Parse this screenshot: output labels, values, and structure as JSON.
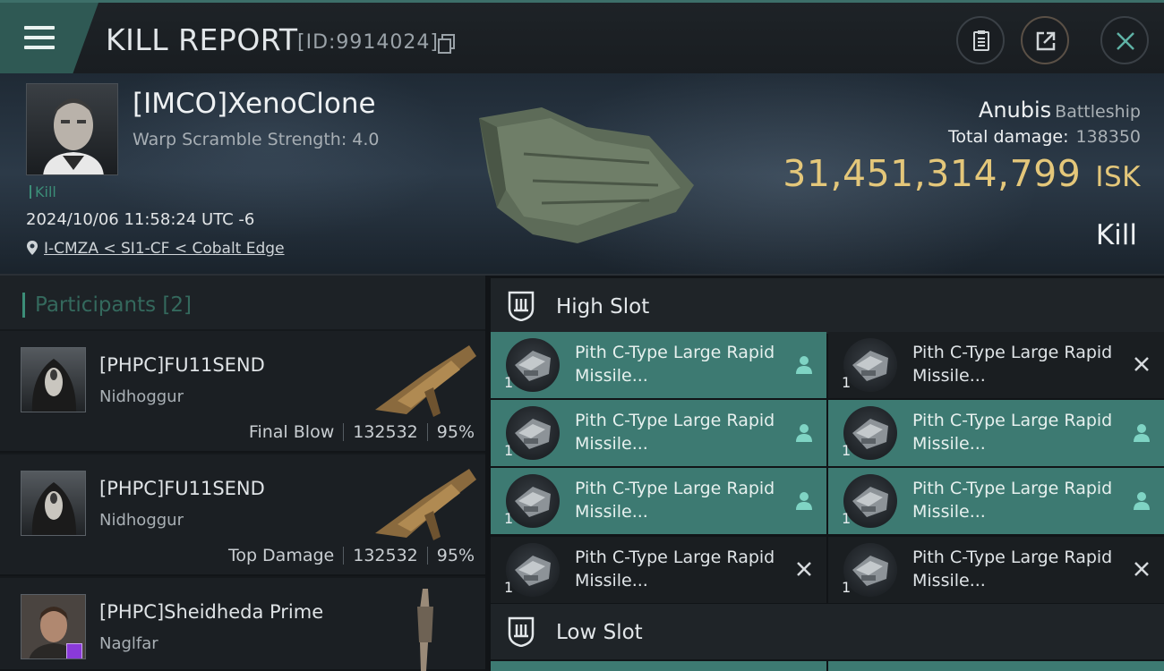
{
  "header": {
    "title": "KILL REPORT",
    "report_id": "[ID:9914024]"
  },
  "victim": {
    "name": "[IMCO]XenoClone",
    "warp_scramble": "Warp Scramble Strength: 4.0",
    "tag": "Kill",
    "datetime": "2024/10/06 11:58:24 UTC -6",
    "location": "I-CMZA < SI1-CF < Cobalt Edge",
    "ship_name": "Anubis",
    "ship_class": "Battleship",
    "total_damage_label": "Total damage:",
    "total_damage": "138350",
    "isk_value": "31,451,314,799",
    "isk_unit": "ISK",
    "result": "Kill"
  },
  "participants": {
    "title": "Participants [2]",
    "rows": [
      {
        "name": "[PHPC]FU11SEND",
        "ship": "Nidhoggur",
        "role": "Final Blow",
        "damage": "132532",
        "percent": "95%"
      },
      {
        "name": "[PHPC]FU11SEND",
        "ship": "Nidhoggur",
        "role": "Top Damage",
        "damage": "132532",
        "percent": "95%"
      },
      {
        "name": "[PHPC]Sheidheda Prime",
        "ship": "Naglfar"
      }
    ]
  },
  "fitting": {
    "high_slot_label": "High Slot",
    "low_slot_label": "Low Slot",
    "modules": [
      {
        "name": "Pith C-Type Large Rapid Missile...",
        "qty": "1",
        "state": "dropped"
      },
      {
        "name": "Pith C-Type Large Rapid Missile...",
        "qty": "1",
        "state": "destroyed"
      },
      {
        "name": "Pith C-Type Large Rapid Missile...",
        "qty": "1",
        "state": "dropped"
      },
      {
        "name": "Pith C-Type Large Rapid Missile...",
        "qty": "1",
        "state": "dropped"
      },
      {
        "name": "Pith C-Type Large Rapid Missile...",
        "qty": "1",
        "state": "dropped"
      },
      {
        "name": "Pith C-Type Large Rapid Missile...",
        "qty": "1",
        "state": "dropped"
      },
      {
        "name": "Pith C-Type Large Rapid Missile...",
        "qty": "1",
        "state": "destroyed"
      },
      {
        "name": "Pith C-Type Large Rapid Missile...",
        "qty": "1",
        "state": "destroyed"
      }
    ]
  },
  "colors": {
    "accent_teal": "#3c8e78",
    "active_module": "#3d7a72",
    "isk_gold": "#e4c77a"
  }
}
